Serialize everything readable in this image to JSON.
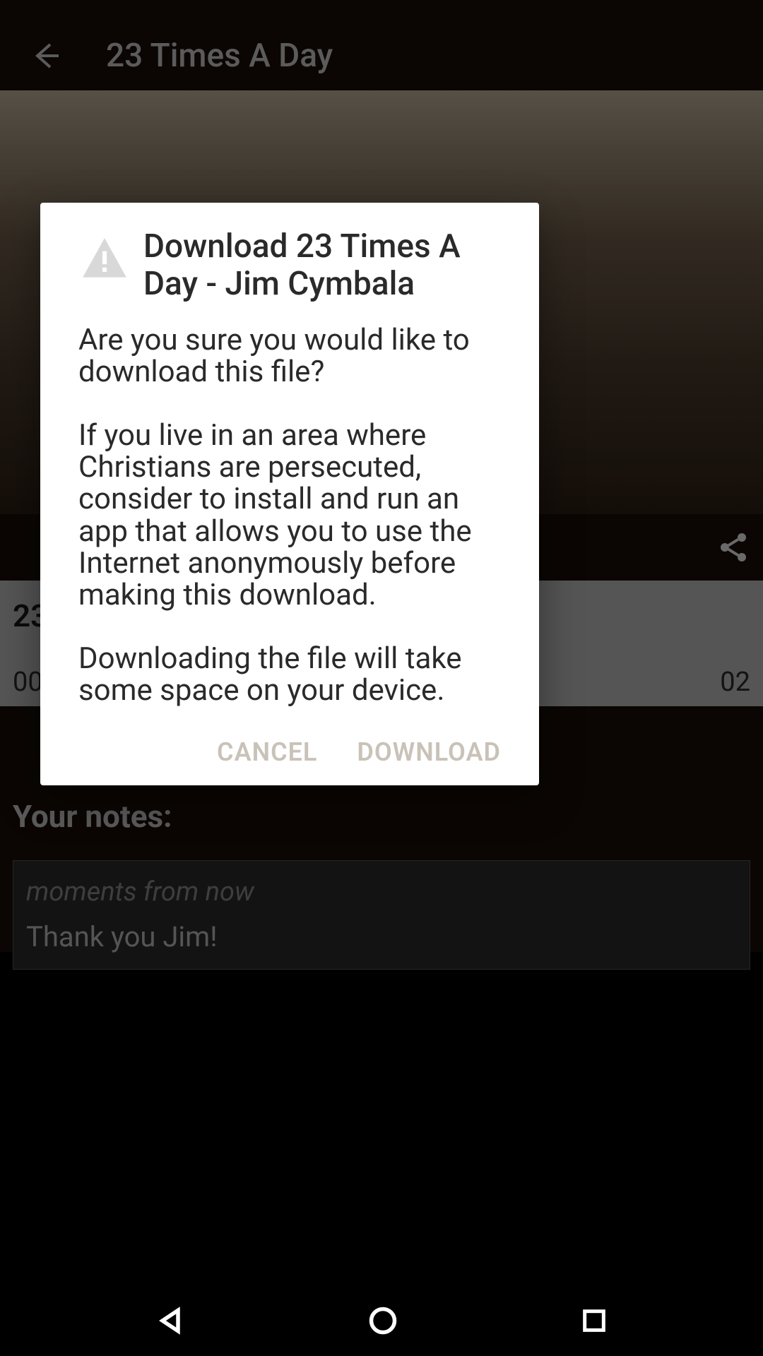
{
  "header": {
    "title": "23 Times A Day"
  },
  "player": {
    "track_title_prefix": "23",
    "time_left_prefix": "00",
    "time_right_suffix": "02"
  },
  "notes": {
    "label": "Your notes:",
    "hint": "moments from now",
    "text": "Thank you Jim!"
  },
  "dialog": {
    "title": "Download 23 Times A Day - Jim Cymbala",
    "paragraphs": [
      "Are you sure you would like to download this file?",
      "If you live in an area where Christians are persecuted, consider to install and run an app that allows you to use the Internet anonymously before making this download.",
      "Downloading the file will take some space on your device."
    ],
    "cancel_label": "CANCEL",
    "download_label": "DOWNLOAD"
  },
  "colors": {
    "dialog_bg": "#ffffff",
    "dialog_text": "#2a2a2a",
    "dialog_button": "#c9c2b8",
    "app_bg": "#1a0f08",
    "panel_bg": "#bdbdbd"
  }
}
